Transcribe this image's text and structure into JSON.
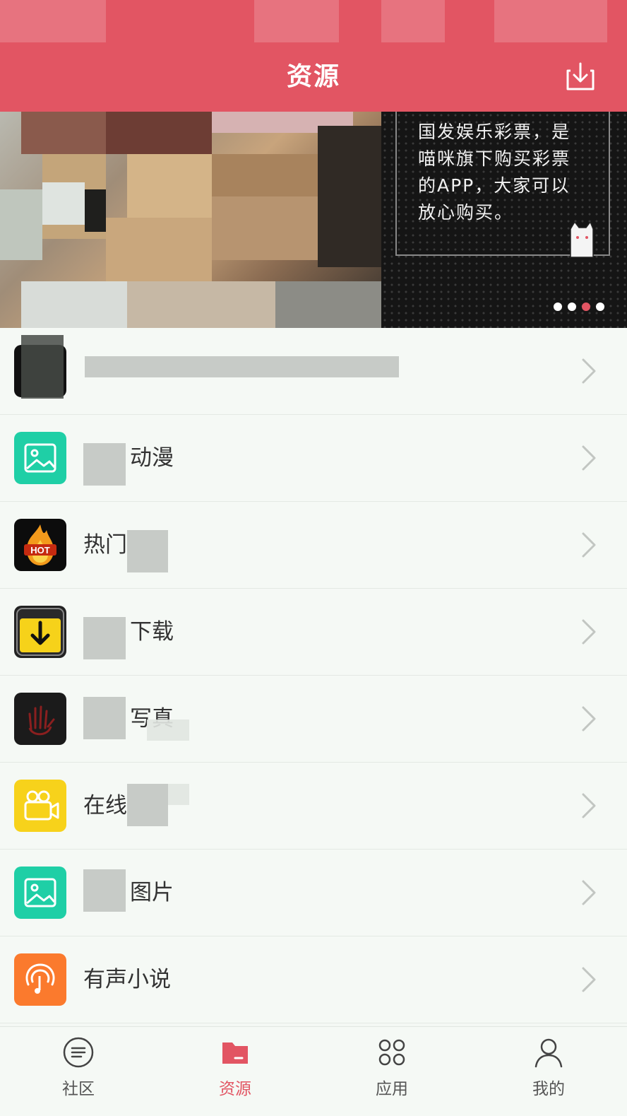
{
  "header": {
    "title": "资源"
  },
  "banner": {
    "ad_text": "国发娱乐彩票，是\n喵咪旗下购买彩票\n的APP，大家可以\n放心购买。",
    "indicator_count": 4,
    "active_index": 2
  },
  "resource_list": [
    {
      "label": "",
      "icon": "video-icon"
    },
    {
      "label": "动漫",
      "icon": "image-icon"
    },
    {
      "label": "热门",
      "icon": "hot-fire-icon"
    },
    {
      "label": "下载",
      "icon": "download-icon"
    },
    {
      "label": "写真",
      "icon": "hand-icon"
    },
    {
      "label": "在线",
      "icon": "video-camera-icon"
    },
    {
      "label": "图片",
      "icon": "image-icon"
    },
    {
      "label": "有声小说",
      "icon": "audio-book-icon"
    }
  ],
  "bottom_nav": {
    "items": [
      {
        "label": "社区",
        "icon": "community-list-icon"
      },
      {
        "label": "资源",
        "icon": "folder-icon"
      },
      {
        "label": "应用",
        "icon": "apps-grid-icon"
      },
      {
        "label": "我的",
        "icon": "profile-icon"
      }
    ],
    "active_index": 1
  },
  "colors": {
    "brand": "#e25563",
    "background": "#f5f9f5",
    "text": "#333333"
  }
}
